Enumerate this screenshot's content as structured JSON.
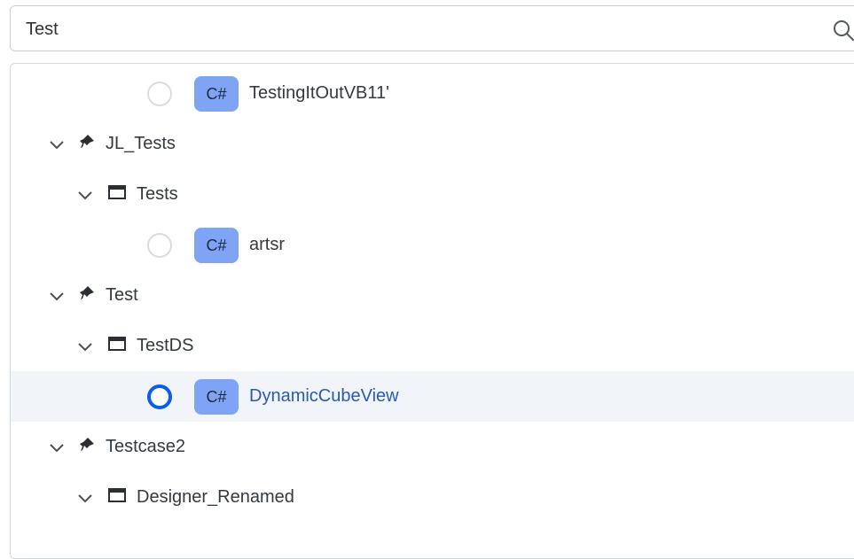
{
  "search": {
    "value": "Test",
    "icon": "search-icon"
  },
  "tree": {
    "rows": [
      {
        "type": "item",
        "badge": "C#",
        "label": "TestingItOutVB11'"
      },
      {
        "type": "group",
        "icon": "pin-icon",
        "label": "JL_Tests"
      },
      {
        "type": "folder",
        "icon": "window-icon",
        "label": "Tests"
      },
      {
        "type": "item",
        "badge": "C#",
        "label": "artsr"
      },
      {
        "type": "group",
        "icon": "pin-icon",
        "label": "Test"
      },
      {
        "type": "folder",
        "icon": "window-icon",
        "label": "TestDS"
      },
      {
        "type": "item",
        "badge": "C#",
        "label": "DynamicCubeView",
        "selected": true
      },
      {
        "type": "group",
        "icon": "pin-icon",
        "label": "Testcase2"
      },
      {
        "type": "folder",
        "icon": "window-icon",
        "label": "Designer_Renamed"
      }
    ]
  },
  "colors": {
    "accent": "#0d5bf0",
    "badge": "#7fa4f6",
    "selected_row": "#f1f4f9",
    "selected_text": "#2a5bb0"
  }
}
